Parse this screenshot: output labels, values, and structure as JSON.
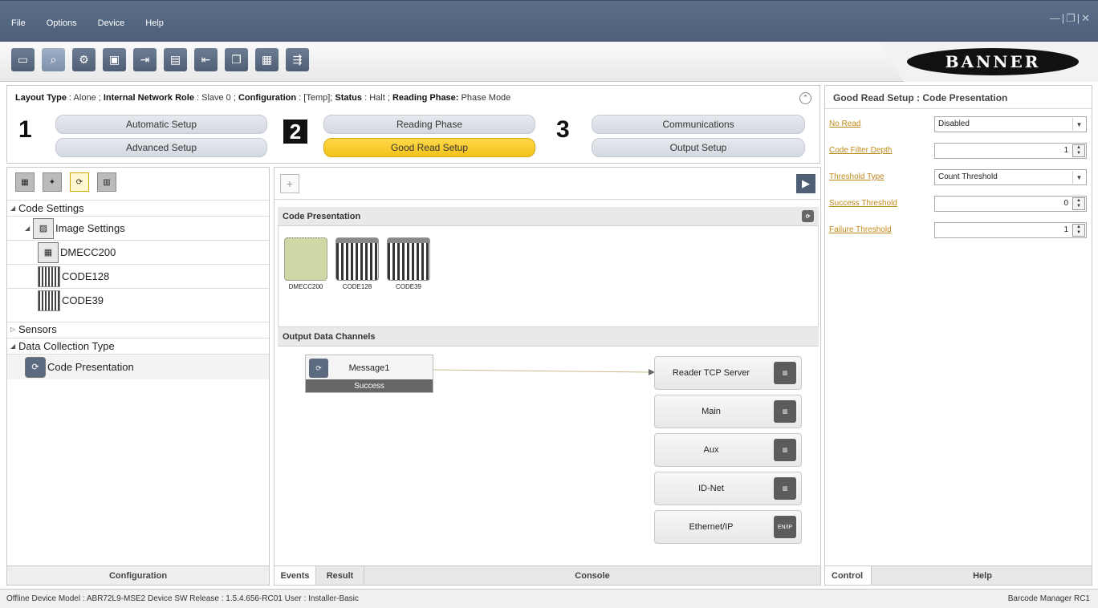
{
  "menu": [
    "File",
    "Options",
    "Device",
    "Help"
  ],
  "window_controls": "—|❐|✕",
  "toolbar": {
    "icons": [
      "device-icon",
      "search-device-icon",
      "user-settings-icon",
      "layout-icon",
      "export-icon",
      "print-icon",
      "import-icon",
      "copy-icon",
      "save-icon",
      "network-icon"
    ],
    "brand": "BANNER"
  },
  "layout_info": {
    "layout_type_label": "Layout Type",
    "layout_type": "Alone",
    "network_role_label": "Internal Network Role",
    "network_role": "Slave 0",
    "configuration_label": "Configuration",
    "configuration": "[Temp]",
    "status_label": "Status",
    "status": "Halt",
    "phase_label": "Reading Phase:",
    "phase": "Phase Mode"
  },
  "steps": {
    "step1": "1",
    "step2": "2",
    "step3": "3",
    "automatic_setup": "Automatic Setup",
    "advanced_setup": "Advanced Setup",
    "reading_phase": "Reading Phase",
    "good_read_setup": "Good Read Setup",
    "communications": "Communications",
    "output_setup": "Output Setup"
  },
  "right_panel": {
    "title": "Good Read Setup : Code Presentation",
    "props": [
      {
        "label": "No Read",
        "value": "Disabled",
        "kind": "select"
      },
      {
        "label": "Code Filter Depth",
        "value": "1",
        "kind": "spin"
      },
      {
        "label": "Threshold Type",
        "value": "Count Threshold",
        "kind": "select"
      },
      {
        "label": "Success Threshold",
        "value": "0",
        "kind": "spin"
      },
      {
        "label": "Failure Threshold",
        "value": "1",
        "kind": "spin"
      }
    ],
    "tabs": [
      "Control",
      "Help"
    ]
  },
  "left_panel": {
    "tree": {
      "code_settings": "Code Settings",
      "image_settings": "Image Settings",
      "dmecc200": "DMECC200",
      "code128": "CODE128",
      "code39": "CODE39",
      "sensors": "Sensors",
      "data_collection_type": "Data Collection Type",
      "code_presentation": "Code Presentation"
    },
    "footer": "Configuration"
  },
  "center_panel": {
    "code_presentation_header": "Code Presentation",
    "codes": [
      "DMECC200",
      "CODE128",
      "CODE39"
    ],
    "output_header": "Output Data Channels",
    "message": {
      "label": "Message1",
      "status": "Success"
    },
    "channels": [
      "Reader TCP Server",
      "Main",
      "Aux",
      "ID-Net",
      "Ethernet/IP"
    ],
    "channel_icon_ethernet": "EN/IP",
    "tabs": [
      "Events",
      "Result",
      "Console"
    ]
  },
  "status_bar": {
    "left": "Offline Device Model : ABR72L9-MSE2   Device SW Release : 1.5.4.656-RC01   User : Installer-Basic",
    "right": "Barcode Manager RC1"
  }
}
